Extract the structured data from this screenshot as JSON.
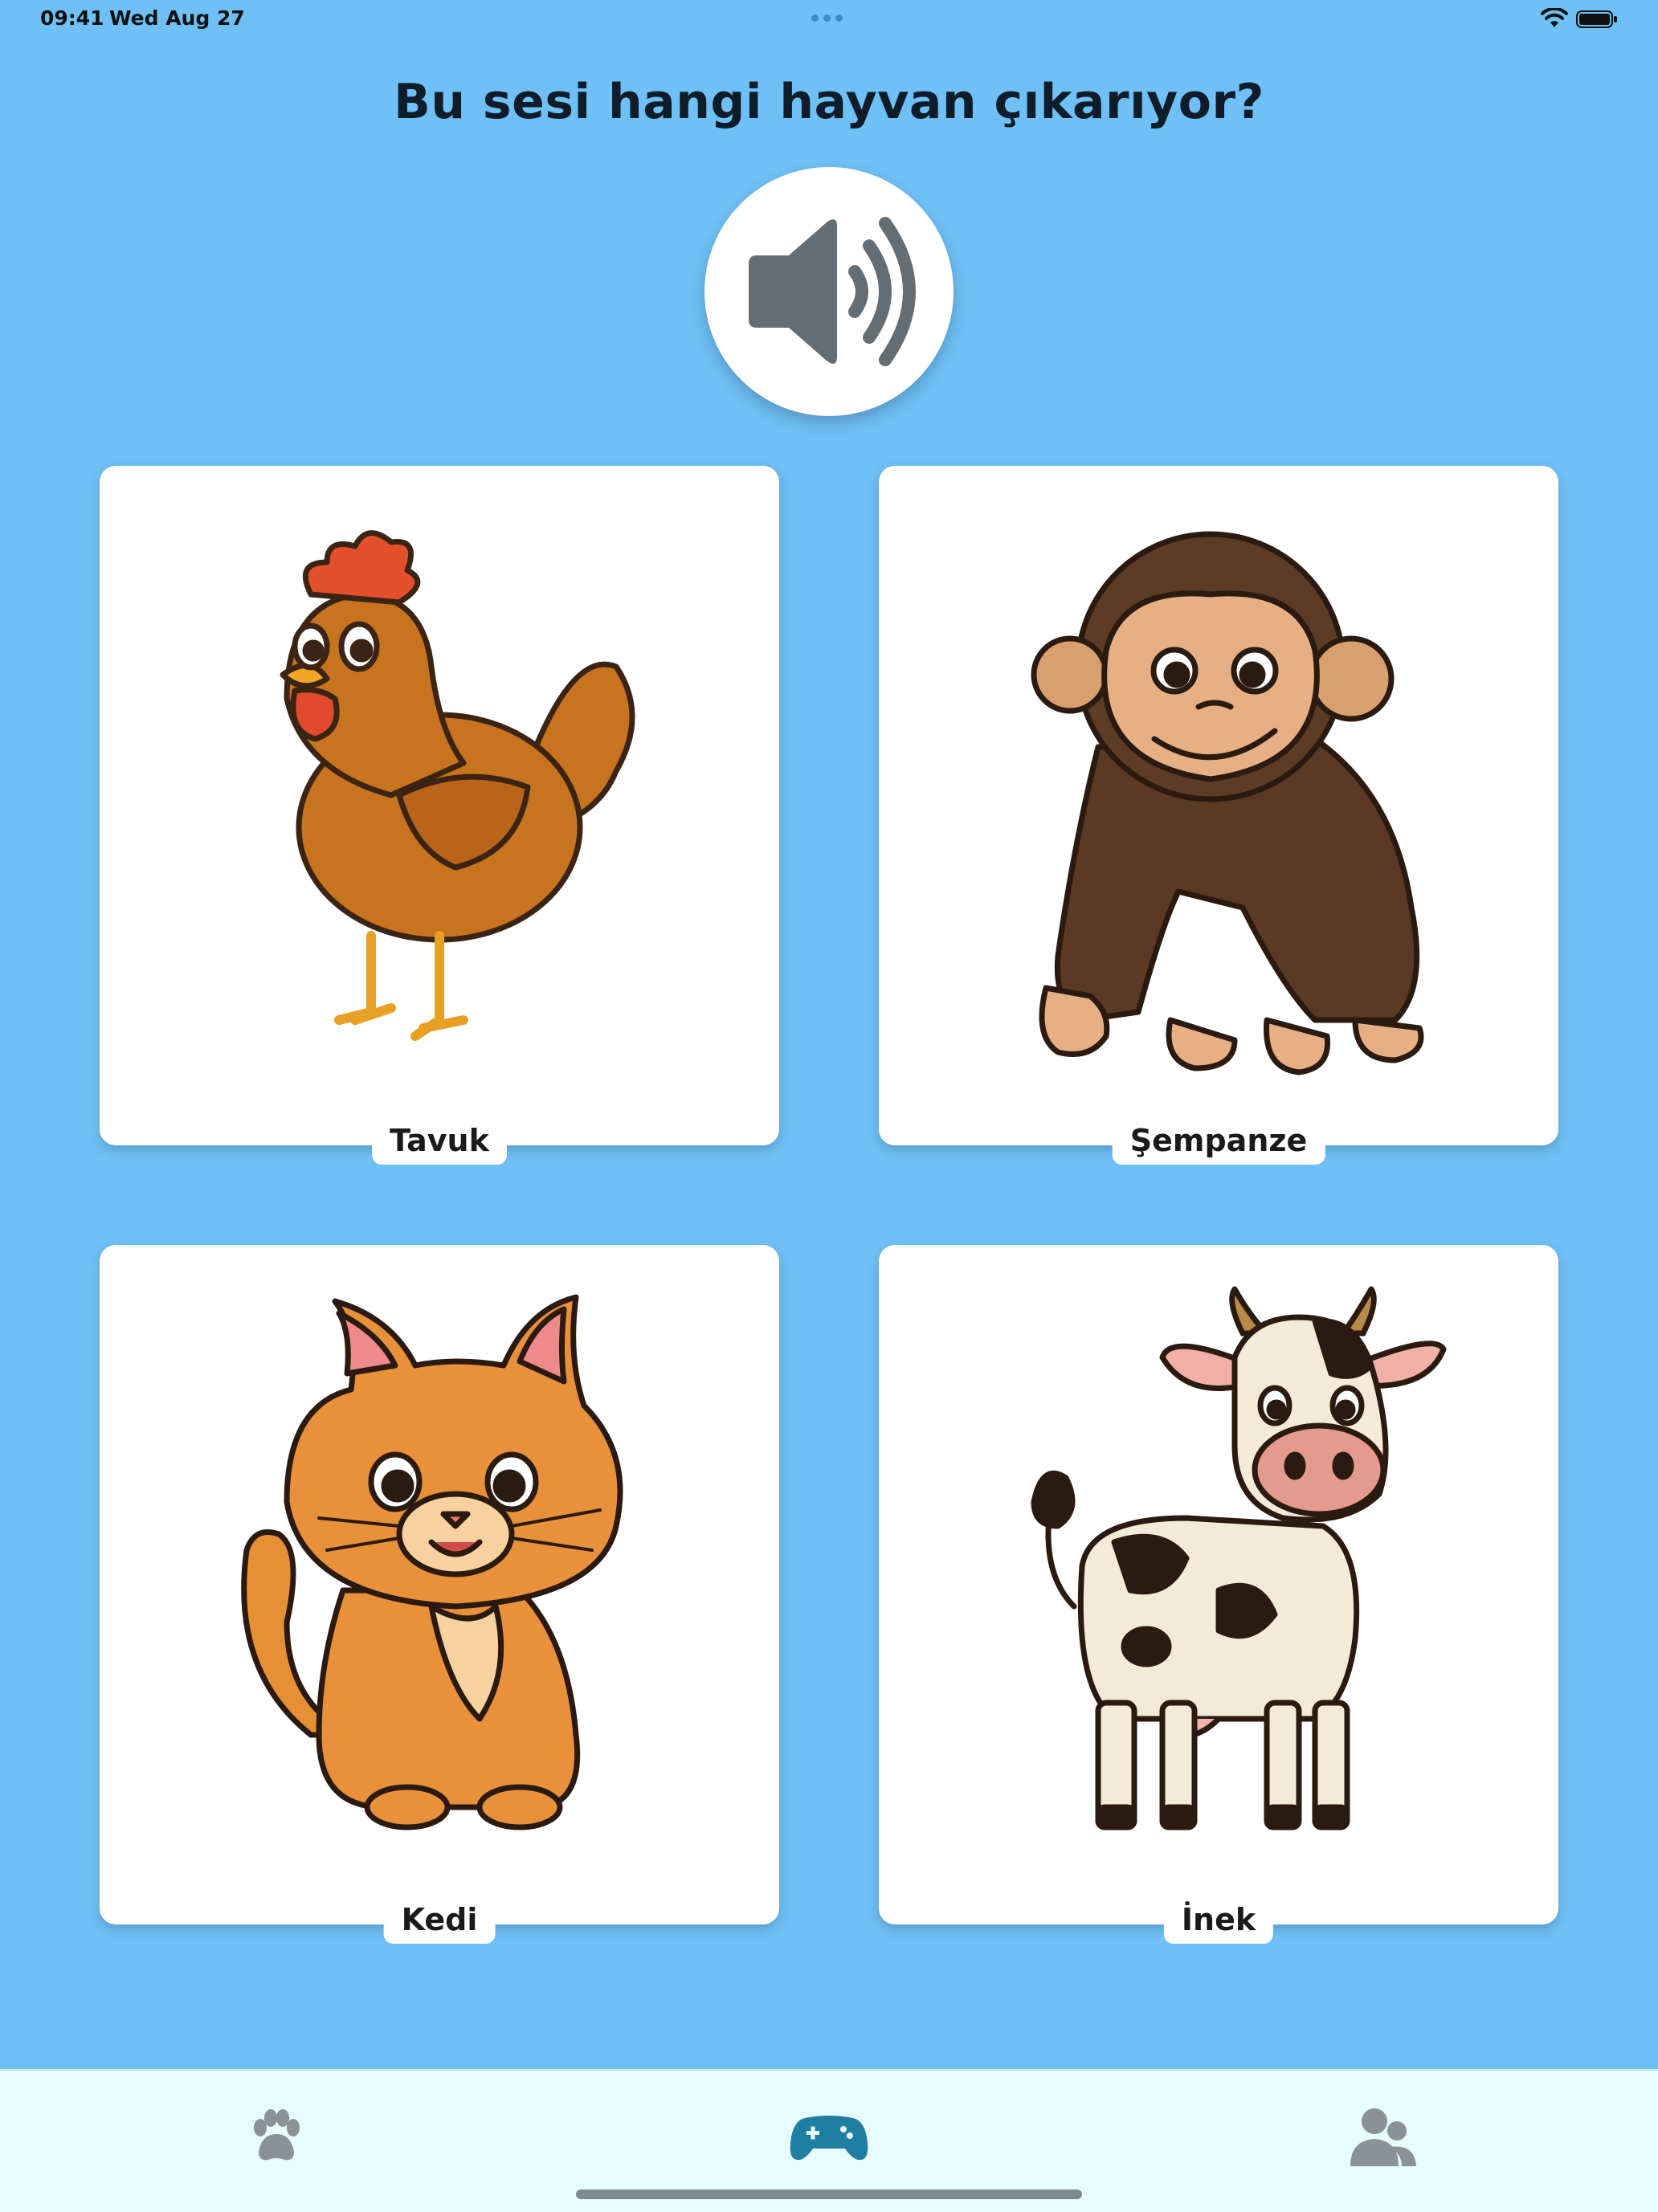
{
  "status_bar": {
    "time": "09:41",
    "date": "Wed Aug 27"
  },
  "question": "Bu sesi hangi hayvan çıkarıyor?",
  "play_button": {
    "icon": "speaker-volume-icon"
  },
  "options": [
    {
      "label": "Tavuk",
      "image": "chicken"
    },
    {
      "label": "Şempanze",
      "image": "chimpanzee"
    },
    {
      "label": "Kedi",
      "image": "cat"
    },
    {
      "label": "İnek",
      "image": "cow"
    }
  ],
  "tab_bar": {
    "tabs": [
      {
        "icon": "paw-icon",
        "active": false
      },
      {
        "icon": "gamepad-icon",
        "active": true
      },
      {
        "icon": "users-icon",
        "active": false
      }
    ],
    "active_color": "#1f7fa3",
    "inactive_color": "#8a9295"
  },
  "colors": {
    "background": "#6fc0f6",
    "card": "#ffffff",
    "tab_bar": "#e6fcfe"
  }
}
